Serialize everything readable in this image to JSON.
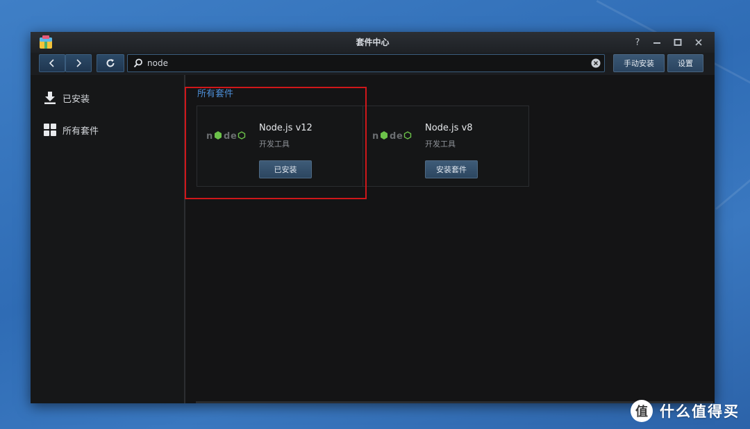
{
  "window": {
    "title": "套件中心"
  },
  "toolbar": {
    "search_value": "node",
    "manual_install_label": "手动安装",
    "settings_label": "设置"
  },
  "sidebar": {
    "items": [
      {
        "label": "已安装",
        "icon": "download-icon"
      },
      {
        "label": "所有套件",
        "icon": "grid-icon"
      }
    ]
  },
  "main": {
    "section_title": "所有套件",
    "packages": [
      {
        "name": "Node.js v12",
        "category": "开发工具",
        "button": "已安装",
        "highlighted": true
      },
      {
        "name": "Node.js v8",
        "category": "开发工具",
        "button": "安装套件",
        "highlighted": false
      }
    ]
  },
  "watermark": {
    "text": "什么值得买"
  },
  "colors": {
    "accent": "#4d8ed6",
    "highlight": "#d0171a",
    "desktop": "#3a76bd"
  }
}
